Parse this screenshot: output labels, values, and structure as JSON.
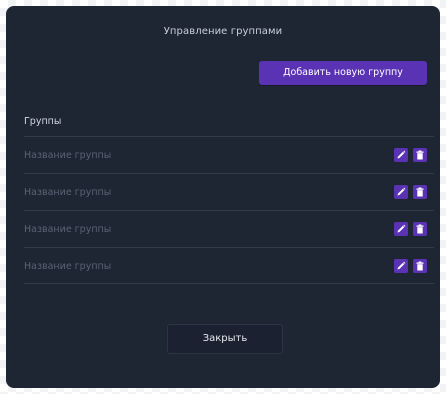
{
  "modal": {
    "title": "Управление группами",
    "add_button_label": "Добавить новую группу",
    "section_title": "Группы",
    "close_button_label": "Закрыть"
  },
  "groups": [
    {
      "name": "Название группы",
      "edit_icon": "pencil-icon",
      "delete_icon": "trash-icon"
    },
    {
      "name": "Название группы",
      "edit_icon": "pencil-icon",
      "delete_icon": "trash-icon"
    },
    {
      "name": "Название группы",
      "edit_icon": "pencil-icon",
      "delete_icon": "trash-icon"
    },
    {
      "name": "Название группы",
      "edit_icon": "pencil-icon",
      "delete_icon": "trash-icon"
    }
  ],
  "colors": {
    "modal_background": "#1e2533",
    "accent": "#5a33b5",
    "divider": "#323b4c",
    "muted_text": "#5a6374"
  }
}
